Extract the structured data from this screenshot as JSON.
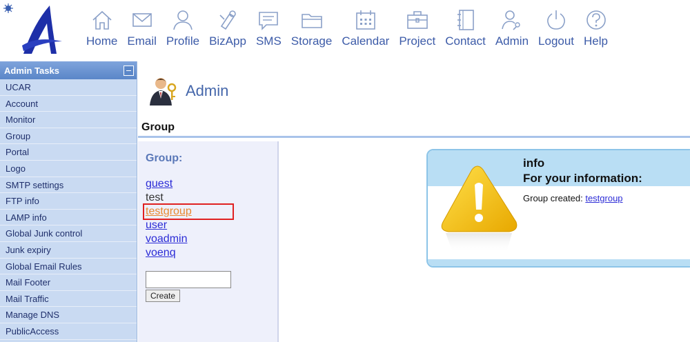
{
  "nav": [
    {
      "label": "Home",
      "icon": "home-icon"
    },
    {
      "label": "Email",
      "icon": "email-icon"
    },
    {
      "label": "Profile",
      "icon": "profile-icon"
    },
    {
      "label": "BizApp",
      "icon": "bizapp-icon"
    },
    {
      "label": "SMS",
      "icon": "sms-icon"
    },
    {
      "label": "Storage",
      "icon": "folder-icon"
    },
    {
      "label": "Calendar",
      "icon": "calendar-icon"
    },
    {
      "label": "Project",
      "icon": "briefcase-icon"
    },
    {
      "label": "Contact",
      "icon": "address-book-icon"
    },
    {
      "label": "Admin",
      "icon": "admin-icon"
    },
    {
      "label": "Logout",
      "icon": "power-icon"
    },
    {
      "label": "Help",
      "icon": "help-icon"
    }
  ],
  "sidebar": {
    "title": "Admin Tasks",
    "items": [
      "UCAR",
      "Account",
      "Monitor",
      "Group",
      "Portal",
      "Logo",
      "SMTP settings",
      "FTP info",
      "LAMP info",
      "Global Junk control",
      "Junk expiry",
      "Global Email Rules",
      "Mail Footer",
      "Mail Traffic",
      "Manage DNS",
      "PublicAccess"
    ]
  },
  "page": {
    "title": "Admin",
    "section": "Group"
  },
  "group_panel": {
    "label": "Group:",
    "groups": [
      {
        "name": "guest",
        "style": "link"
      },
      {
        "name": "test",
        "style": "plain"
      },
      {
        "name": "testgroup",
        "style": "active"
      },
      {
        "name": "user",
        "style": "link"
      },
      {
        "name": "voadmin",
        "style": "link"
      },
      {
        "name": "voenq",
        "style": "link"
      }
    ],
    "input_value": "",
    "create_label": "Create"
  },
  "info": {
    "title": "info",
    "subtitle": "For your information:",
    "message_prefix": "Group created: ",
    "message_link": "testgroup"
  },
  "colors": {
    "nav_text": "#3c5ba8",
    "sidebar_bg": "#c9daf2",
    "link": "#2b2bd6",
    "active_link": "#e8892f",
    "highlight": "#e02020"
  }
}
